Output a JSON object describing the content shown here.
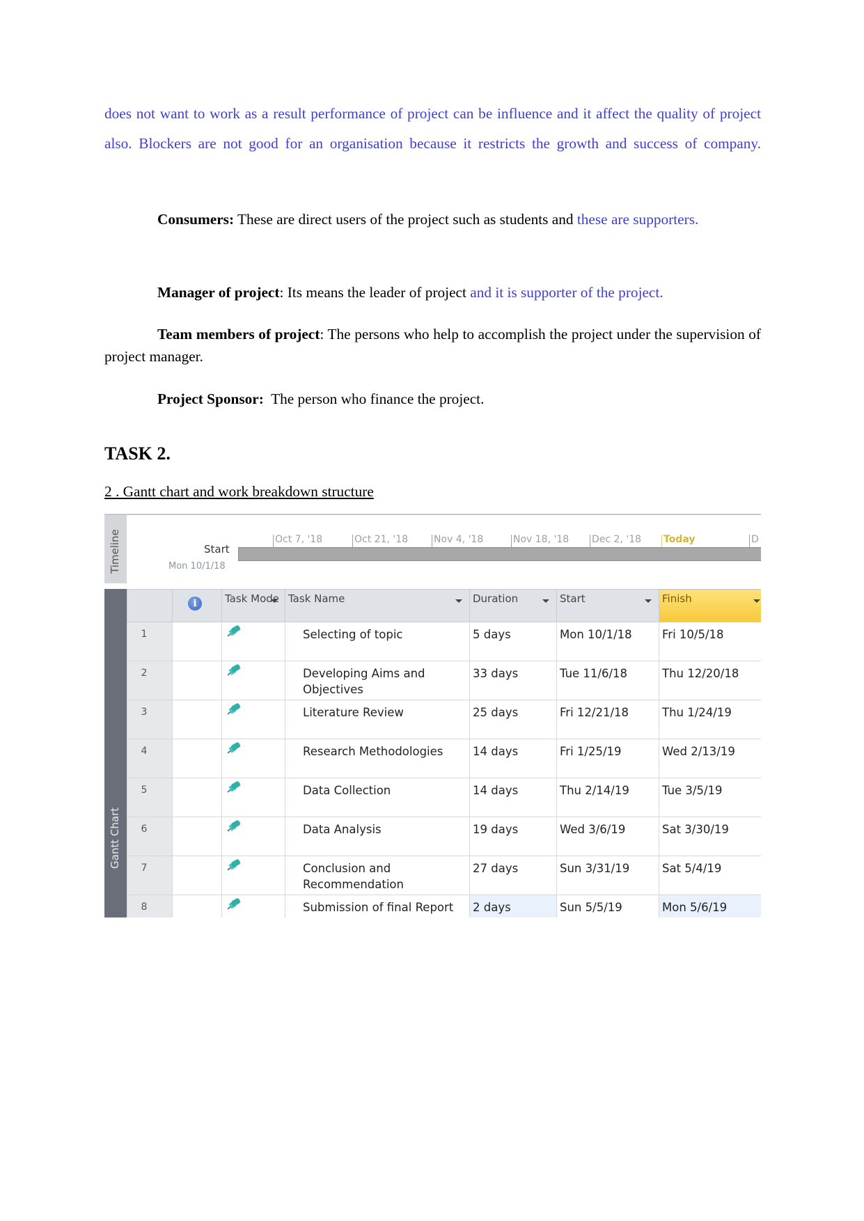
{
  "paragraphs": {
    "blockers_continued": "does not want to work as a result performance of project can be influence and it affect the quality of project also. Blockers are not good for an organisation because it restricts the growth and success of company.",
    "consumers": {
      "term": "Consumers:",
      "text": " These are direct users of the project such as students and ",
      "highlight": "these are supporters."
    },
    "manager": {
      "term": "Manager of project",
      "text": ": Its means the leader of project ",
      "highlight": "and it is supporter of the project."
    },
    "team": {
      "term": "Team members of project",
      "text": ": The persons who help to accomplish the project under the supervision of project manager."
    },
    "sponsor": {
      "term": "Project Sponsor:",
      "text": "  The person who finance the project."
    }
  },
  "heading": "TASK 2.",
  "subheading": "2 . Gantt chart and work breakdown structure",
  "gantt": {
    "timeline": {
      "side_label": "Timeline",
      "start_label": "Start",
      "start_date": "Mon 10/1/18",
      "ticks": [
        "Oct 7, '18",
        "Oct 21, '18",
        "Nov 4, '18",
        "Nov 18, '18",
        "Dec 2, '18",
        "Today",
        "D"
      ]
    },
    "side_label": "Gantt Chart",
    "columns": {
      "indicators": "i",
      "task_mode": "Task Mode",
      "task_name": "Task Name",
      "duration": "Duration",
      "start": "Start",
      "finish": "Finish"
    },
    "rows": [
      {
        "id": "1",
        "name": "Selecting of topic",
        "duration": "5 days",
        "start": "Mon 10/1/18",
        "finish": "Fri 10/5/18"
      },
      {
        "id": "2",
        "name": "Developing Aims and Objectives",
        "duration": "33 days",
        "start": "Tue 11/6/18",
        "finish": "Thu 12/20/18"
      },
      {
        "id": "3",
        "name": "Literature Review",
        "duration": "25 days",
        "start": "Fri 12/21/18",
        "finish": "Thu 1/24/19"
      },
      {
        "id": "4",
        "name": "Research Methodologies",
        "duration": "14 days",
        "start": "Fri 1/25/19",
        "finish": "Wed 2/13/19"
      },
      {
        "id": "5",
        "name": "Data Collection",
        "duration": "14 days",
        "start": "Thu 2/14/19",
        "finish": "Tue 3/5/19"
      },
      {
        "id": "6",
        "name": "Data Analysis",
        "duration": "19 days",
        "start": "Wed 3/6/19",
        "finish": "Sat 3/30/19"
      },
      {
        "id": "7",
        "name": "Conclusion and Recommendation",
        "duration": "27 days",
        "start": "Sun 3/31/19",
        "finish": "Sat 5/4/19"
      },
      {
        "id": "8",
        "name": "Submission of final Report",
        "duration": "2 days",
        "start": "Sun 5/5/19",
        "finish": "Mon 5/6/19"
      }
    ]
  }
}
